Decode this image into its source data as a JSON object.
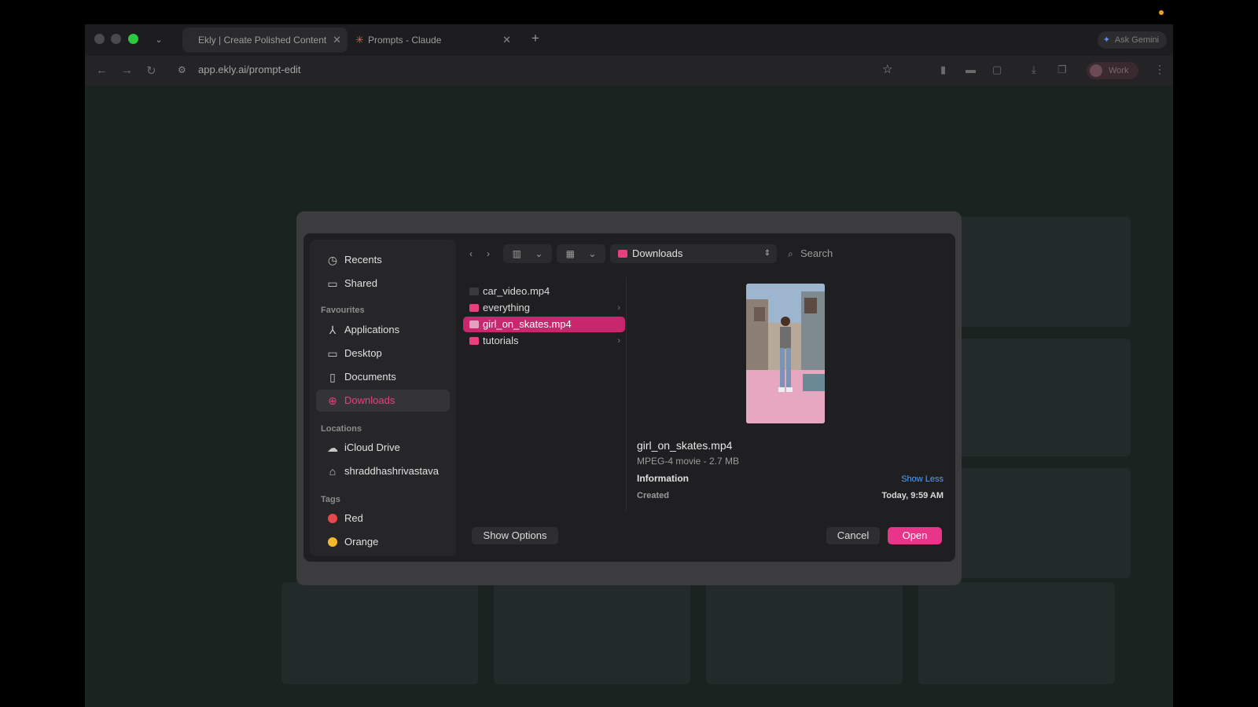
{
  "browser": {
    "tabs": [
      {
        "label": "Ekly | Create Polished Content"
      },
      {
        "label": "Prompts - Claude"
      }
    ],
    "ask_gemini_label": "Ask Gemini",
    "url": "app.ekly.ai/prompt-edit",
    "profile_label": "Work"
  },
  "sidebar": {
    "top_items": [
      {
        "label": "Recents",
        "icon": "clock-icon"
      },
      {
        "label": "Shared",
        "icon": "shared-folder-icon"
      }
    ],
    "favourites_header": "Favourites",
    "favourites": [
      {
        "label": "Applications",
        "icon": "applications-icon"
      },
      {
        "label": "Desktop",
        "icon": "desktop-icon"
      },
      {
        "label": "Documents",
        "icon": "document-icon"
      },
      {
        "label": "Downloads",
        "icon": "download-icon",
        "active": true
      }
    ],
    "locations_header": "Locations",
    "locations": [
      {
        "label": "iCloud Drive",
        "icon": "cloud-icon"
      },
      {
        "label": "shraddhashrivastava",
        "icon": "home-icon"
      }
    ],
    "tags_header": "Tags",
    "tags": [
      {
        "label": "Red",
        "color": "#e5484d"
      },
      {
        "label": "Orange",
        "color": "#f5b82e"
      }
    ]
  },
  "toolbar": {
    "location": "Downloads",
    "search_placeholder": "Search"
  },
  "files": [
    {
      "name": "car_video.mp4",
      "kind": "video"
    },
    {
      "name": "everything",
      "kind": "folder"
    },
    {
      "name": "girl_on_skates.mp4",
      "kind": "video",
      "selected": true
    },
    {
      "name": "tutorials",
      "kind": "folder"
    }
  ],
  "preview": {
    "name": "girl_on_skates.mp4",
    "kind": "MPEG-4 movie - 2.7 MB",
    "info_header": "Information",
    "show_less": "Show Less",
    "created_label": "Created",
    "created_value": "Today, 9:59 AM"
  },
  "buttons": {
    "show_options": "Show Options",
    "cancel": "Cancel",
    "open": "Open"
  },
  "colors": {
    "accent": "#e8358a",
    "selection": "#c8266d"
  }
}
